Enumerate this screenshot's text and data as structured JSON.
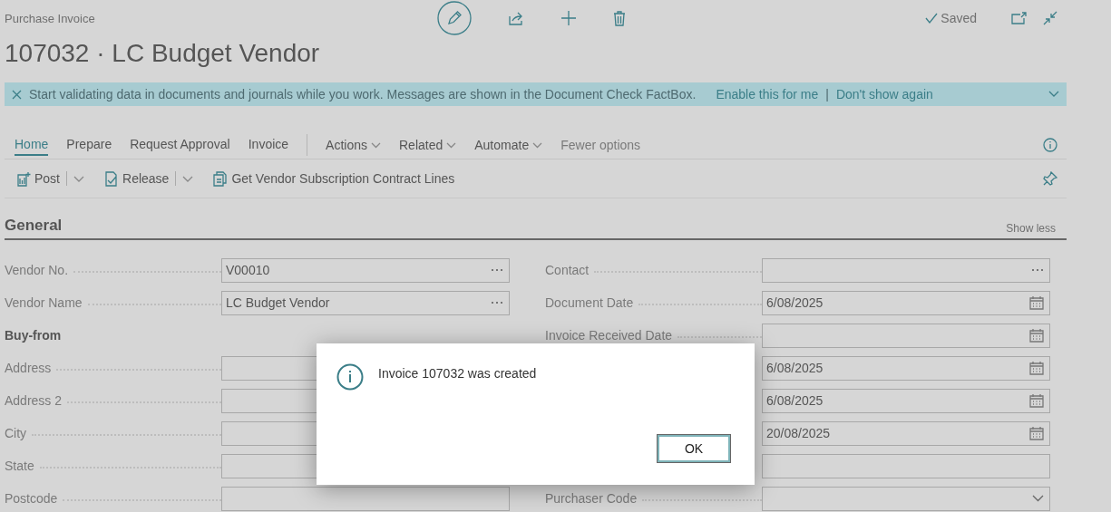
{
  "header": {
    "page_type": "Purchase Invoice",
    "title": "107032 · LC Budget Vendor",
    "status": "Saved"
  },
  "banner": {
    "message": "Start validating data in documents and journals while you work. Messages are shown in the Document Check FactBox.",
    "links": [
      "Enable this for me",
      "Don't show again"
    ],
    "separator": "|"
  },
  "tabs": [
    {
      "label": "Home",
      "selected": true
    },
    {
      "label": "Prepare",
      "selected": false
    },
    {
      "label": "Request Approval",
      "selected": false
    },
    {
      "label": "Invoice",
      "selected": false
    }
  ],
  "menus": [
    "Actions",
    "Related",
    "Automate"
  ],
  "fewer_options": "Fewer options",
  "actions": [
    {
      "label": "Post",
      "split": true
    },
    {
      "label": "Release",
      "split": true
    },
    {
      "label": "Get Vendor Subscription Contract Lines",
      "split": false
    }
  ],
  "section": {
    "title": "General",
    "toggle": "Show less"
  },
  "left_fields": [
    {
      "kind": "lookup",
      "label": "Vendor No.",
      "value": "V00010"
    },
    {
      "kind": "lookup",
      "label": "Vendor Name",
      "value": "LC Budget Vendor"
    },
    {
      "kind": "heading",
      "label": "Buy-from"
    },
    {
      "kind": "plain",
      "label": "Address"
    },
    {
      "kind": "plain",
      "label": "Address 2"
    },
    {
      "kind": "plain",
      "label": "City"
    },
    {
      "kind": "plain",
      "label": "State"
    },
    {
      "kind": "plain",
      "label": "Postcode"
    }
  ],
  "right_fields": [
    {
      "kind": "lookup",
      "label": "Contact"
    },
    {
      "kind": "date",
      "label": "Document Date",
      "value": "6/08/2025"
    },
    {
      "kind": "date",
      "label": "Invoice Received Date"
    },
    {
      "kind": "date",
      "value": "6/08/2025"
    },
    {
      "kind": "date",
      "value": "6/08/2025"
    },
    {
      "kind": "date",
      "value": "20/08/2025"
    },
    {
      "kind": "plain"
    },
    {
      "kind": "dropdown",
      "label": "Purchaser Code"
    }
  ],
  "dialog": {
    "message": "Invoice 107032 was created",
    "button": "OK"
  }
}
